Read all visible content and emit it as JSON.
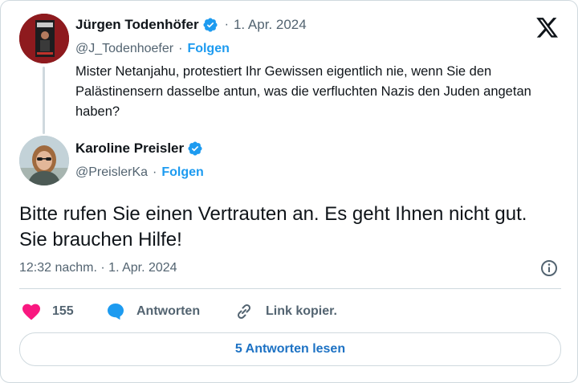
{
  "quoted_tweet": {
    "author_name": "Jürgen Todenhöfer",
    "separator": "·",
    "date": "1. Apr. 2024",
    "handle": "@J_Todenhoefer",
    "follow_label": "Folgen",
    "text": "Mister Netanjahu, protestiert Ihr Gewissen eigentlich nie, wenn Sie den Palästinensern dasselbe antun, was die verfluchten Nazis den Juden angetan haben?"
  },
  "reply": {
    "author_name": "Karoline Preisler",
    "handle": "@PreislerKa",
    "follow_label": "Folgen",
    "text": "Bitte rufen Sie einen Vertrauten an. Es geht Ihnen nicht gut. Sie brauchen Hilfe!",
    "timestamp": "12:32 nachm. · 1. Apr. 2024"
  },
  "actions": {
    "like_count": "155",
    "reply_label": "Antworten",
    "copy_link_label": "Link kopier."
  },
  "read_replies_label": "5 Antworten lesen",
  "icons": {
    "platform": "x-logo-icon",
    "verified": "verified-badge-icon",
    "info": "info-icon",
    "like": "heart-icon",
    "reply": "speech-bubble-icon",
    "link": "link-icon"
  },
  "colors": {
    "accent": "#1d9bf0",
    "like": "#f91880",
    "text": "#0f1419",
    "muted": "#536471",
    "border": "#cfd9de"
  }
}
